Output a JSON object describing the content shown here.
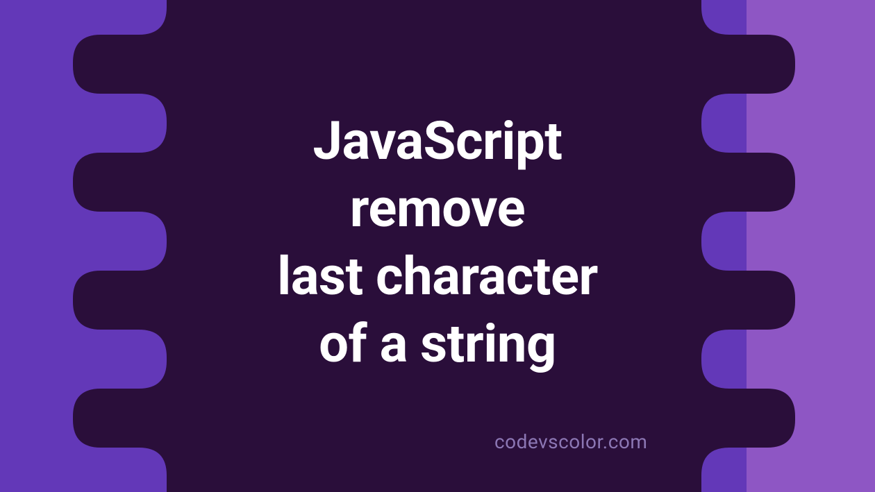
{
  "title_lines": [
    "JavaScript",
    "remove",
    "last character",
    "of a string"
  ],
  "watermark": "codevscolor.com",
  "colors": {
    "left_bg": "#6338B8",
    "right_bg": "#8E56C4",
    "blob": "#2A0E3A",
    "text": "#FFFFFF",
    "watermark": "#8C77B4"
  }
}
